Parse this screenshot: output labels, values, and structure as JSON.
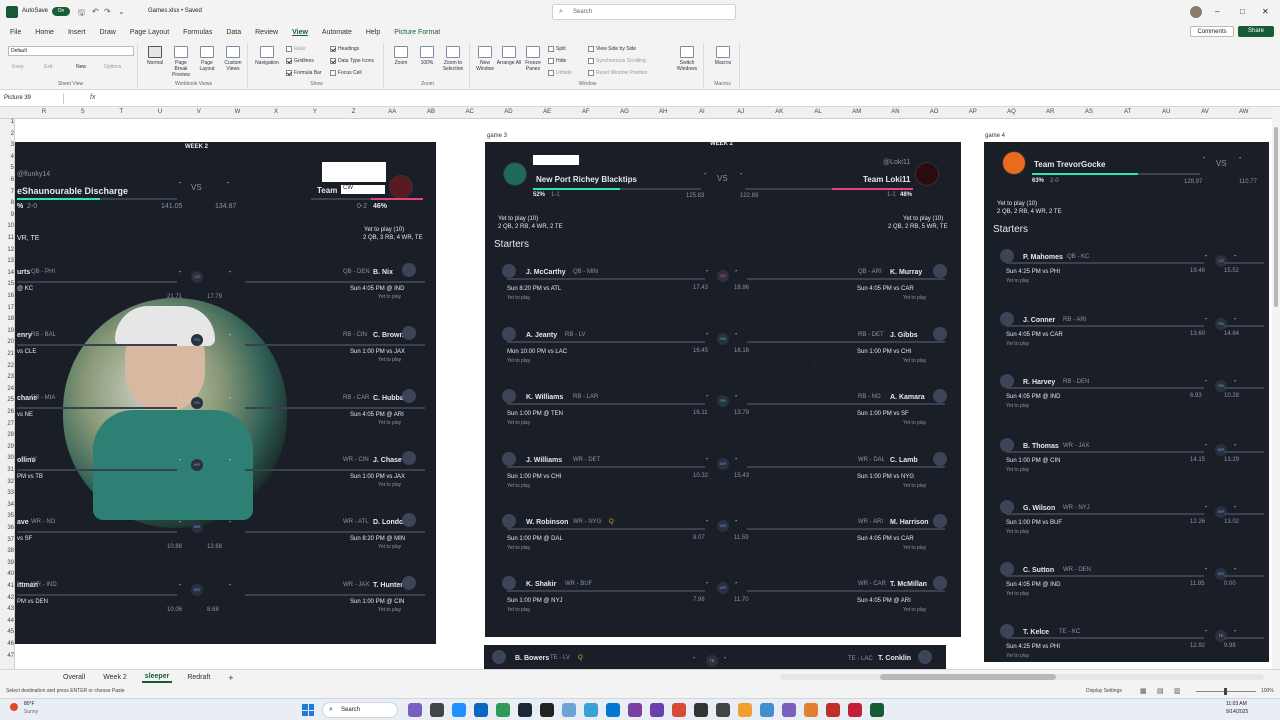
{
  "title_bar": {
    "autosave_label": "AutoSave",
    "autosave_state": "On",
    "file_name": "Games.xlsx • Saved",
    "search_placeholder": "Search",
    "window_controls": [
      "–",
      "□",
      "✕"
    ]
  },
  "menu": {
    "items": [
      "File",
      "Home",
      "Insert",
      "Draw",
      "Page Layout",
      "Formulas",
      "Data",
      "Review",
      "View",
      "Automate",
      "Help",
      "Picture Format"
    ],
    "active": "View",
    "comments_label": "Comments",
    "share_label": "Share"
  },
  "ribbon": {
    "sheet_view": {
      "dropdown_value": "Default",
      "keep": "Keep",
      "exit": "Exit",
      "new": "New",
      "options": "Options",
      "group_label": "Sheet View"
    },
    "workbook_views": {
      "normal": "Normal",
      "page_break": "Page Break Preview",
      "page_layout": "Page Layout",
      "custom_views": "Custom Views",
      "group_label": "Workbook Views"
    },
    "show": {
      "navigation": "Navigation",
      "ruler": "Ruler",
      "headings": "Headings",
      "gridlines": "Gridlines",
      "data_type_icons": "Data Type Icons",
      "formula_bar": "Formula Bar",
      "focus_cell": "Focus Cell",
      "group_label": "Show"
    },
    "zoom": {
      "zoom": "Zoom",
      "hundred": "100%",
      "zoom_to_selection": "Zoom to Selection",
      "group_label": "Zoom"
    },
    "window": {
      "new_window": "New Window",
      "arrange_all": "Arrange All",
      "freeze_panes": "Freeze Panes",
      "split": "Split",
      "hide": "Hide",
      "unhide": "Unhide",
      "side_by_side": "View Side by Side",
      "sync_scroll": "Synchronous Scrolling",
      "reset_pos": "Reset Window Position",
      "switch_windows": "Switch Windows",
      "group_label": "Window"
    },
    "macros": {
      "macros": "Macros",
      "group_label": "Macros"
    }
  },
  "formula_bar": {
    "name_box": "Picture 39",
    "fx": "fx",
    "value": ""
  },
  "columns": [
    "R",
    "S",
    "T",
    "U",
    "V",
    "W",
    "X",
    "Y",
    "Z",
    "AA",
    "AB",
    "AC",
    "AD",
    "AE",
    "AF",
    "AG",
    "AH",
    "AI",
    "AJ",
    "AK",
    "AL",
    "AM",
    "AN",
    "AO",
    "AP",
    "AQ",
    "AR",
    "AS",
    "AT",
    "AU",
    "AV",
    "AW"
  ],
  "rows": [
    "1",
    "2",
    "3",
    "4",
    "5",
    "6",
    "7",
    "8",
    "9",
    "10",
    "11",
    "12",
    "13",
    "14",
    "15",
    "16",
    "17",
    "18",
    "19",
    "20",
    "21",
    "22",
    "23",
    "24",
    "25",
    "26",
    "27",
    "28",
    "29",
    "30",
    "31",
    "32",
    "33",
    "34",
    "35",
    "36",
    "37",
    "38",
    "39",
    "40",
    "41",
    "42",
    "43",
    "44",
    "45",
    "46",
    "47"
  ],
  "cell_labels": {
    "game3": "game 3",
    "game4": "game 4"
  },
  "left_panel": {
    "week": "WEEK 2",
    "user_left": "@flunky14",
    "team_left": "eShaunourable Discharge",
    "team_right": "Team",
    "team_right_tag": "CW",
    "vs": "VS",
    "dash": "-",
    "record_left": "2-0",
    "pct_left": "%",
    "score_left": "141.05",
    "score_right": "134.87",
    "record_right": "0-2",
    "pct_right": "46%",
    "yet_left": "VR, TE",
    "yet_right": "Yet to play (10)",
    "yet_right_detail": "2 QB, 3 RB, 4 WR, TE",
    "rows": [
      {
        "l_name": "urts",
        "l_pos": "QB - PHI",
        "l_game": "@ KC",
        "l_pts": "21.71",
        "r_pts": "17.79",
        "r_pos": "QB - DEN",
        "r_name": "B. Nix",
        "r_game": "Sun 4:05 PM @ IND",
        "r_status": "Yet to play",
        "badge": "QB"
      },
      {
        "l_name": "enry",
        "l_pos": "RB - BAL",
        "l_game": "vs CLE",
        "l_pts": "",
        "r_pts": "17.87",
        "r_pos": "RB - CIN",
        "r_name": "C. Brown",
        "r_game": "Sun 1:00 PM vs JAX",
        "r_status": "Yet to play",
        "badge": "RB"
      },
      {
        "l_name": "chane",
        "l_pos": "RB - MIA",
        "l_game": "vs NE",
        "l_pts": "",
        "r_pts": "",
        "r_pos": "RB - CAR",
        "r_name": "C. Hubbard",
        "r_game": "Sun 4:05 PM @ ARI",
        "r_status": "Yet to play",
        "badge": "RB"
      },
      {
        "l_name": "ollins",
        "l_pos": "W",
        "l_game": "PM vs TB",
        "l_pts": "",
        "r_pts": "",
        "r_pos": "WR - CIN",
        "r_name": "J. Chase",
        "r_game": "Sun 1:00 PM vs JAX",
        "r_status": "Yet to play",
        "badge": "WR"
      },
      {
        "l_name": "ave",
        "l_pos": "WR - NO",
        "l_game": "vs SF",
        "l_pts": "10.88",
        "r_pts": "12.68",
        "r_pos": "WR - ATL",
        "r_name": "D. London",
        "r_game": "Sun 8:20 PM @ MIN",
        "r_status": "Yet to play",
        "badge": "WR"
      },
      {
        "l_name": "ittman",
        "l_pos": "WR - IND",
        "l_game": "PM vs DEN",
        "l_pts": "10.06",
        "r_pts": "8.68",
        "r_pos": "WR - JAX",
        "r_name": "T. Hunter",
        "r_game": "Sun 1:00 PM @ CIN",
        "r_status": "Yet to play",
        "badge": "WR"
      }
    ]
  },
  "center_panel": {
    "week": "WEEK 2",
    "team_left": "New Port Richey Blacktips",
    "user_right": "@Loki11",
    "team_right": "Team Loki11",
    "vs": "VS",
    "dash": "-",
    "pct_left": "52%",
    "record_left": "1-1",
    "score_left": "125.83",
    "score_right": "122.89",
    "record_right": "1-1",
    "pct_right": "48%",
    "yet_left": "Yet to play (10)",
    "yet_left_detail": "2 QB, 2 RB, 4 WR, 2 TE",
    "yet_right": "Yet to play (10)",
    "yet_right_detail": "2 QB, 2 RB, 5 WR, TE",
    "starters_label": "Starters",
    "rows": [
      {
        "l_name": "J. McCarthy",
        "l_pos": "QB - MIN",
        "l_game": "Sun 8:20 PM vs ATL",
        "l_status": "Yet to play",
        "l_pts": "17.43",
        "r_pts": "18.96",
        "r_pos": "QB - ARI",
        "r_name": "K. Murray",
        "r_game": "Sun 4:05 PM vs CAR",
        "r_status": "Yet to play",
        "badge": "QB"
      },
      {
        "l_name": "A. Jeanty",
        "l_pos": "RB - LV",
        "l_game": "Mon 10:00 PM vs LAC",
        "l_status": "Yet to play",
        "l_pts": "16.45",
        "r_pts": "16.16",
        "r_pos": "RB - DET",
        "r_name": "J. Gibbs",
        "r_game": "Sun 1:00 PM vs CHI",
        "r_status": "Yet to play",
        "badge": "RB"
      },
      {
        "l_name": "K. Williams",
        "l_pos": "RB - LAR",
        "l_game": "Sun 1:00 PM @ TEN",
        "l_status": "Yet to play",
        "l_pts": "16.11",
        "r_pts": "13.79",
        "r_pos": "RB - NO",
        "r_name": "A. Kamara",
        "r_game": "Sun 1:00 PM vs SF",
        "r_status": "Yet to play",
        "badge": "RB"
      },
      {
        "l_name": "J. Williams",
        "l_pos": "WR - DET",
        "l_game": "Sun 1:00 PM vs CHI",
        "l_status": "Yet to play",
        "l_pts": "10.32",
        "r_pts": "15.43",
        "r_pos": "WR - DAL",
        "r_name": "C. Lamb",
        "r_game": "Sun 1:00 PM vs NYG",
        "r_status": "Yet to play",
        "badge": "WR"
      },
      {
        "l_name": "W. Robinson",
        "l_pos": "WR - NYG",
        "l_tag": "Q",
        "l_game": "Sun 1:00 PM @ DAL",
        "l_status": "Yet to play",
        "l_pts": "8.07",
        "r_pts": "11.59",
        "r_pos": "WR - ARI",
        "r_name": "M. Harrison",
        "r_game": "Sun 4:05 PM vs CAR",
        "r_status": "Yet to play",
        "badge": "WR"
      },
      {
        "l_name": "K. Shakir",
        "l_pos": "WR - BUF",
        "l_game": "Sun 1:00 PM @ NYJ",
        "l_status": "Yet to play",
        "l_pts": "7.98",
        "r_pts": "11.70",
        "r_pos": "WR - CAR",
        "r_name": "T. McMillan",
        "r_game": "Sun 4:05 PM @ ARI",
        "r_status": "Yet to play",
        "badge": "WR"
      }
    ],
    "bottom_row": {
      "l_name": "B. Bowers",
      "l_pos": "TE - LV",
      "l_tag": "Q",
      "r_pos": "TE - LAC",
      "r_name": "T. Conklin",
      "badge": "TE"
    }
  },
  "right_panel": {
    "team": "Team TrevorGocke",
    "vs": "VS",
    "dash": "-",
    "pct": "63%",
    "record": "2-0",
    "score_left": "128.97",
    "score_right": "110.77",
    "yet": "Yet to play (10)",
    "yet_detail": "2 QB, 2 RB, 4 WR, 2 TE",
    "starters_label": "Starters",
    "rows": [
      {
        "name": "P. Mahomes",
        "pos": "QB - KC",
        "game": "Sun 4:25 PM vs PHI",
        "status": "Yet to play",
        "pts": "19.46",
        "opp_pts": "15.52",
        "badge": "QB"
      },
      {
        "name": "J. Conner",
        "pos": "RB - ARI",
        "game": "Sun 4:05 PM vs CAR",
        "status": "Yet to play",
        "pts": "13.60",
        "opp_pts": "14.84",
        "badge": "RB"
      },
      {
        "name": "R. Harvey",
        "pos": "RB - DEN",
        "game": "Sun 4:05 PM @ IND",
        "status": "Yet to play",
        "pts": "6.93",
        "opp_pts": "10.28",
        "badge": "RB"
      },
      {
        "name": "B. Thomas",
        "pos": "WR - JAX",
        "game": "Sun 1:00 PM @ CIN",
        "status": "Yet to play",
        "pts": "14.15",
        "opp_pts": "13.29",
        "badge": "WR"
      },
      {
        "name": "G. Wilson",
        "pos": "WR - NYJ",
        "game": "Sun 1:00 PM vs BUF",
        "status": "Yet to play",
        "pts": "12.26",
        "opp_pts": "13.02",
        "badge": "WR"
      },
      {
        "name": "C. Sutton",
        "pos": "WR - DEN",
        "game": "Sun 4:05 PM @ IND",
        "status": "Yet to play",
        "pts": "11.85",
        "opp_pts": "0.00",
        "badge": "WR"
      },
      {
        "name": "T. Kelce",
        "pos": "TE - KC",
        "game": "Sun 4:25 PM vs PHI",
        "status": "Yet to play",
        "pts": "12.92",
        "opp_pts": "9.98",
        "badge": "TE"
      }
    ]
  },
  "sheet_tabs": [
    "Overall",
    "Week 2",
    "sleeper",
    "Redraft"
  ],
  "active_sheet": "sleeper",
  "add_sheet": "+",
  "status_bar": {
    "message": "Select destination and press ENTER or choose Paste",
    "display_settings": "Display Settings",
    "zoom": "100%"
  },
  "taskbar": {
    "weather_temp": "80°F",
    "weather_desc": "Sunny",
    "search": "Search",
    "time": "11:03 AM",
    "date": "9/14/2025"
  },
  "colors": {
    "excel_green": "#185c37",
    "panel_bg": "#1a1e27",
    "accent_teal": "#2ee6a8",
    "accent_pink": "#e6457a"
  }
}
